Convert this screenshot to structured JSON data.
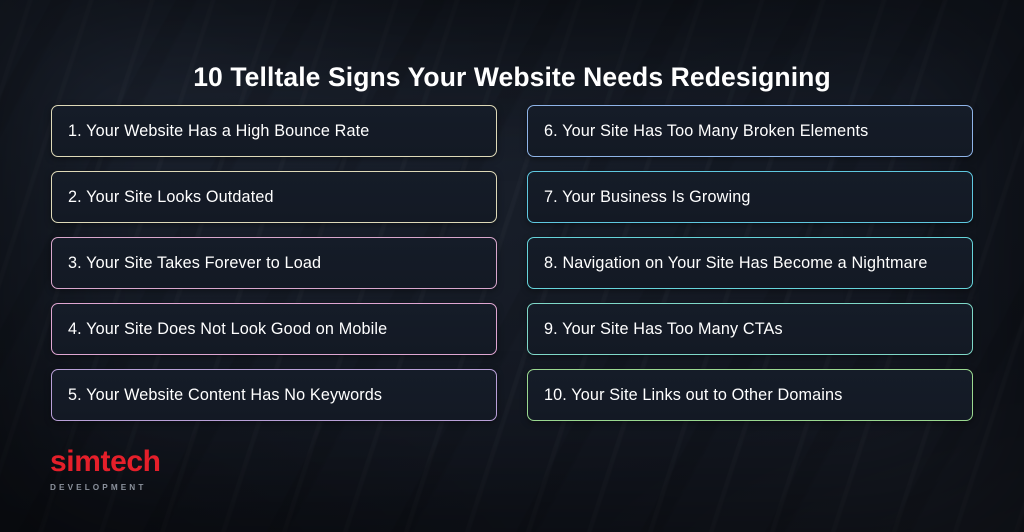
{
  "slide": {
    "title": "10 Telltale Signs Your Website Needs Redesigning",
    "background_color": "#171c27",
    "text_color": "#ffffff"
  },
  "signs": {
    "column_left": [
      {
        "text": "1. Your Website Has a High Bounce Rate",
        "border_color": "#ded9b8"
      },
      {
        "text": "2. Your Site Looks Outdated",
        "border_color": "#ded9b8"
      },
      {
        "text": "3. Your Site Takes Forever to Load",
        "border_color": "#d9a7cd"
      },
      {
        "text": "4. Your Site Does Not Look Good on Mobile",
        "border_color": "#dfa6d2"
      },
      {
        "text": "5. Your Website Content Has No Keywords",
        "border_color": "#b9a0d8"
      }
    ],
    "column_right": [
      {
        "text": "6. Your Site Has Too Many Broken Elements",
        "border_color": "#8fb4e8"
      },
      {
        "text": "7. Your Business Is Growing",
        "border_color": "#5fc8e0"
      },
      {
        "text": "8. Navigation on Your Site Has Become a Nightmare",
        "border_color": "#66d4da"
      },
      {
        "text": "9. Your Site Has Too Many CTAs",
        "border_color": "#7fd8c8"
      },
      {
        "text": "10. Your Site Links out to Other Domains",
        "border_color": "#9ad890"
      }
    ]
  },
  "logo": {
    "word": "simtech",
    "sub": "DEVELOPMENT",
    "word_color": "#e51f2a",
    "sub_color": "#8b919c"
  }
}
